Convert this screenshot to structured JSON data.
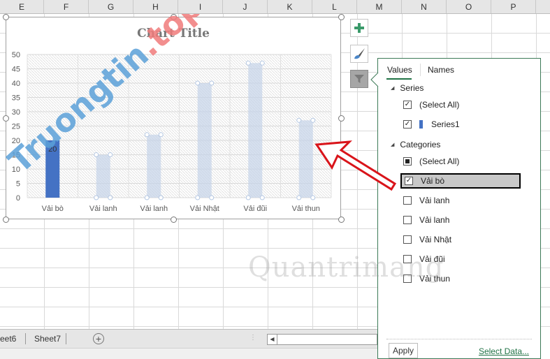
{
  "columns": [
    "E",
    "F",
    "G",
    "H",
    "I",
    "J",
    "K",
    "L",
    "M",
    "N",
    "O",
    "P"
  ],
  "chart_data": {
    "type": "bar",
    "title": "Chart Title",
    "categories": [
      "Vải bò",
      "Vải lanh",
      "Vải lanh",
      "Vải Nhật",
      "Vải đũi",
      "Vải thun"
    ],
    "series": [
      {
        "name": "Series1",
        "values": [
          20,
          15,
          22,
          40,
          47,
          27
        ],
        "highlighted": [
          true,
          false,
          false,
          false,
          false,
          false
        ]
      }
    ],
    "data_labels": [
      "20",
      "",
      "",
      "",
      "",
      ""
    ],
    "ylim": [
      0,
      50
    ],
    "yticks": [
      "0",
      "5",
      "10",
      "15",
      "20",
      "25",
      "30",
      "35",
      "40",
      "45",
      "50"
    ],
    "grid": true,
    "color": "#4472c4",
    "faded_color": "#c5d3e8"
  },
  "chart_buttons": [
    {
      "icon": "plus-icon",
      "name": "chart-elements"
    },
    {
      "icon": "brush-icon",
      "name": "chart-styles"
    },
    {
      "icon": "funnel-icon",
      "name": "chart-filters"
    }
  ],
  "filter_panel": {
    "tabs": [
      "Values",
      "Names"
    ],
    "active_tab": "Values",
    "series_header": "Series",
    "series_items": [
      {
        "label": "(Select All)",
        "state": "checked"
      },
      {
        "label": "Series1",
        "state": "checked"
      }
    ],
    "categories_header": "Categories",
    "category_items": [
      {
        "label": "(Select All)",
        "state": "partial"
      },
      {
        "label": "Vải bò",
        "state": "checked"
      },
      {
        "label": "Vải lanh",
        "state": "unchecked"
      },
      {
        "label": "Vải lanh",
        "state": "unchecked"
      },
      {
        "label": "Vải Nhật",
        "state": "unchecked"
      },
      {
        "label": "Vải đũi",
        "state": "unchecked"
      },
      {
        "label": "Vải thun",
        "state": "unchecked"
      }
    ],
    "apply_label": "Apply",
    "select_data_label": "Select Data..."
  },
  "sheet_tabs": [
    "eet6",
    "Sheet7"
  ],
  "watermarks": {
    "top": "Truongtin.top",
    "bottom": "Quantrimang"
  },
  "accent_color": "#217346"
}
